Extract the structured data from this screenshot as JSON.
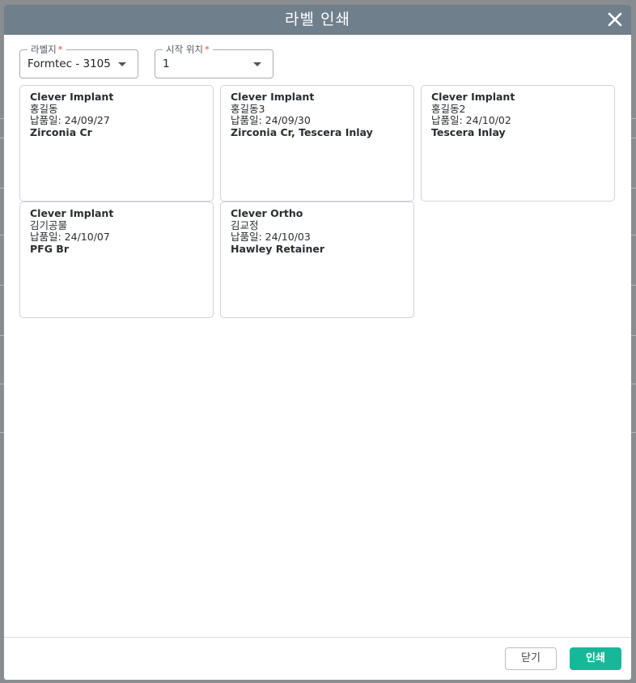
{
  "dialog": {
    "title": "라벨 인쇄",
    "close_icon": "close-icon"
  },
  "fields": {
    "label_paper": {
      "label": "라벨지",
      "required_mark": "*",
      "value": "Formtec - 3105"
    },
    "start_position": {
      "label": "시작 위치",
      "required_mark": "*",
      "value": "1"
    }
  },
  "labels": [
    {
      "company": "Clever Implant",
      "patient": "홍길동",
      "delivery": "납품일: 24/09/27",
      "product": "Zirconia Cr"
    },
    {
      "company": "Clever Implant",
      "patient": "홍길동3",
      "delivery": "납품일: 24/09/30",
      "product": "Zirconia Cr, Tescera Inlay"
    },
    {
      "company": "Clever Implant",
      "patient": "홍길동2",
      "delivery": "납품일: 24/10/02",
      "product": "Tescera Inlay"
    },
    {
      "company": "Clever Implant",
      "patient": "김기공물",
      "delivery": "납품일: 24/10/07",
      "product": "PFG Br"
    },
    {
      "company": "Clever Ortho",
      "patient": "김교정",
      "delivery": "납품일: 24/10/03",
      "product": "Hawley Retainer"
    }
  ],
  "footer": {
    "close_label": "닫기",
    "print_label": "인쇄"
  },
  "colors": {
    "header_bg": "#6f7f8c",
    "print_button": "#17b89a",
    "required": "#d9534f"
  }
}
